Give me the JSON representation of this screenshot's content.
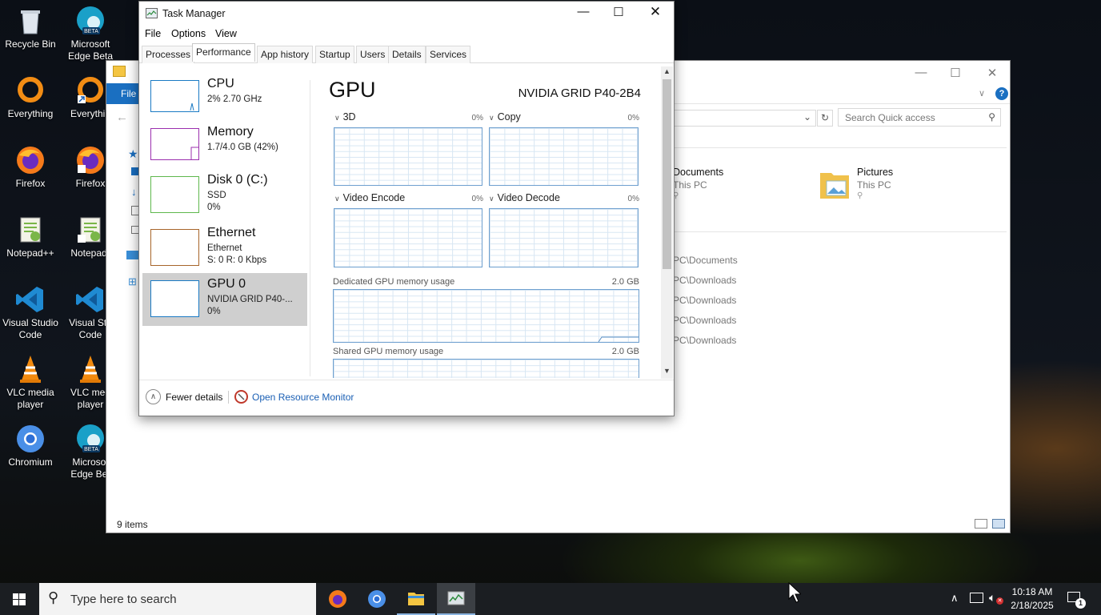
{
  "desktop_icons": [
    {
      "label": "Recycle Bin",
      "icon": "recycle-bin-icon"
    },
    {
      "label": "Microsoft Edge Beta",
      "icon": "edge-beta-icon"
    },
    {
      "label": "Everything",
      "icon": "everything-icon"
    },
    {
      "label": "Everythin",
      "icon": "everything-icon"
    },
    {
      "label": "Firefox",
      "icon": "firefox-icon"
    },
    {
      "label": "Firefox",
      "icon": "firefox-icon"
    },
    {
      "label": "Notepad++",
      "icon": "notepadpp-icon"
    },
    {
      "label": "Notepad-",
      "icon": "notepadpp-icon"
    },
    {
      "label": "Visual Studio Code",
      "icon": "vscode-icon"
    },
    {
      "label": "Visual Stu Code",
      "icon": "vscode-icon"
    },
    {
      "label": "VLC media player",
      "icon": "vlc-icon"
    },
    {
      "label": "VLC med player",
      "icon": "vlc-icon"
    },
    {
      "label": "Chromium",
      "icon": "chromium-icon"
    },
    {
      "label": "Microsof Edge Bet",
      "icon": "edge-beta-icon"
    }
  ],
  "explorer": {
    "menu_file": "File",
    "search_placeholder": "Search Quick access",
    "items": [
      {
        "name": "Documents",
        "location": "This PC"
      },
      {
        "name": "Pictures",
        "location": "This PC"
      }
    ],
    "recent": [
      "PC\\Documents",
      "PC\\Downloads",
      "PC\\Downloads",
      "PC\\Downloads",
      "PC\\Downloads"
    ],
    "status": "9 items"
  },
  "taskmanager": {
    "title": "Task Manager",
    "menu": [
      "File",
      "Options",
      "View"
    ],
    "tabs": [
      "Processes",
      "Performance",
      "App history",
      "Startup",
      "Users",
      "Details",
      "Services"
    ],
    "active_tab": "Performance",
    "sidebar": [
      {
        "name": "CPU",
        "line2": "2% 2.70 GHz",
        "line3": "",
        "color": "#1a7ac4"
      },
      {
        "name": "Memory",
        "line2": "1.7/4.0 GB (42%)",
        "line3": "",
        "color": "#9b2fae"
      },
      {
        "name": "Disk 0 (C:)",
        "line2": "SSD",
        "line3": "0%",
        "color": "#5fb84d"
      },
      {
        "name": "Ethernet",
        "line2": "Ethernet",
        "line3": "S: 0 R: 0 Kbps",
        "color": "#a7652a"
      },
      {
        "name": "GPU 0",
        "line2": "NVIDIA GRID P40-...",
        "line3": "0%",
        "color": "#1a7ac4"
      }
    ],
    "gpu": {
      "title": "GPU",
      "model": "NVIDIA GRID P40-2B4",
      "engines": [
        {
          "name": "3D",
          "pct": "0%"
        },
        {
          "name": "Copy",
          "pct": "0%"
        },
        {
          "name": "Video Encode",
          "pct": "0%"
        },
        {
          "name": "Video Decode",
          "pct": "0%"
        }
      ],
      "dedicated_label": "Dedicated GPU memory usage",
      "dedicated_max": "2.0 GB",
      "shared_label": "Shared GPU memory usage",
      "shared_max": "2.0 GB"
    },
    "fewer_details": "Fewer details",
    "open_resource_monitor": "Open Resource Monitor"
  },
  "taskbar": {
    "search_placeholder": "Type here to search",
    "apps": [
      "firefox-icon",
      "chromium-icon",
      "file-explorer-icon",
      "task-manager-icon"
    ],
    "time": "10:18 AM",
    "date": "2/18/2025",
    "notification_count": "1"
  }
}
